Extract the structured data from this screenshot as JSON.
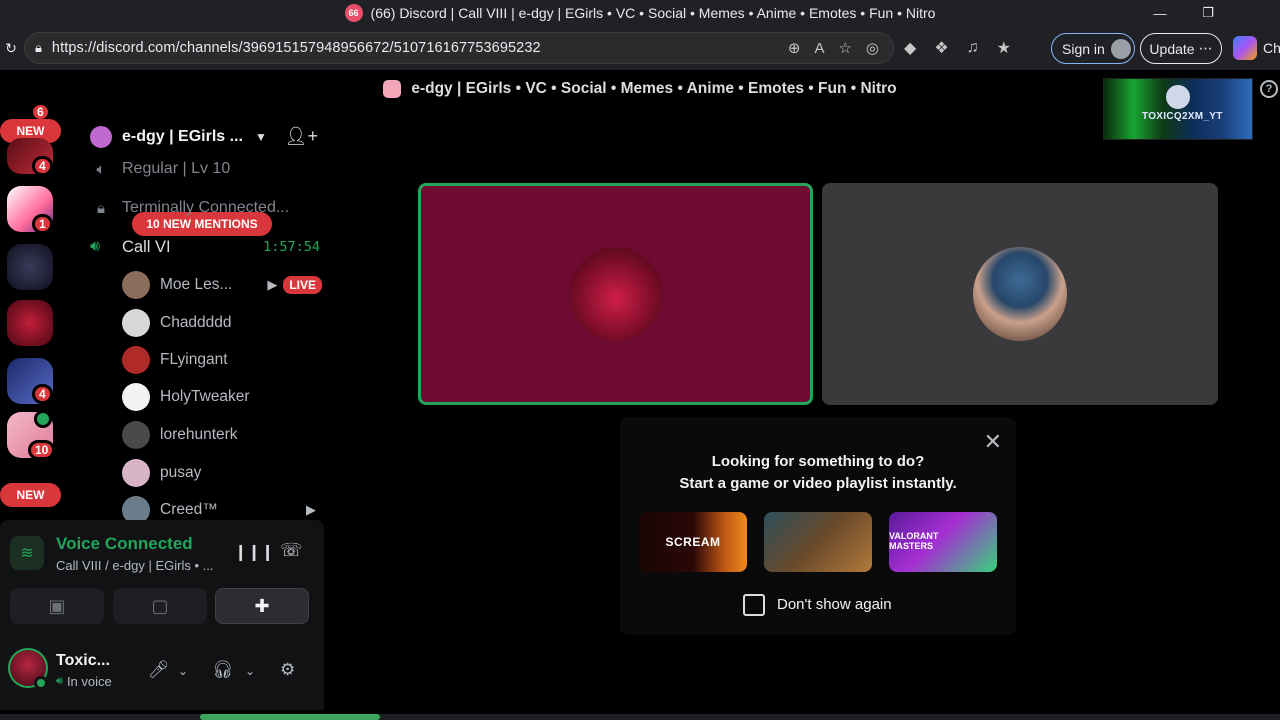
{
  "browser": {
    "tab_badge": "66",
    "tab_title": "(66) Discord | Call VIII | e-dgy | EGirls • VC • Social • Memes • Anime • Emotes • Fun • Nitro",
    "url": "https://discord.com/channels/396915157948956672/510716167753695232",
    "signin_label": "Sign in",
    "update_label": "Update",
    "copilot_label": "Ch"
  },
  "server_header": {
    "title": "e-dgy | EGirls • VC • Social • Memes • Anime • Emotes • Fun • Nitro"
  },
  "overlay": {
    "text": "TOXICQ2XM_YT"
  },
  "rail": {
    "new_label_top": "NEW",
    "new_label_bottom": "NEW",
    "badges": [
      "6",
      "4",
      "1",
      "4",
      "10"
    ]
  },
  "sidebar": {
    "guild_name": "e-dgy | EGirls ...",
    "channels": [
      {
        "name": "Regular | Lv 10",
        "icon": "speaker-icon"
      },
      {
        "name": "Terminally Connected...",
        "icon": "lock-icon"
      }
    ],
    "mentions_label": "10 NEW MENTIONS",
    "call": {
      "name": "Call VI",
      "time": "1:57:54"
    },
    "members": [
      {
        "name": "Moe Les...",
        "live": "LIVE",
        "color": "#8a6d5c"
      },
      {
        "name": "Chaddddd",
        "color": "#d8d8d8"
      },
      {
        "name": "FLyingant",
        "color": "#b02a2a"
      },
      {
        "name": "HolyTweaker",
        "color": "#f2f2f2"
      },
      {
        "name": "lorehunterk",
        "color": "#4a4a4a"
      },
      {
        "name": "pusay",
        "color": "#d9b3c6"
      },
      {
        "name": "Creed™",
        "color": "#6b7c8a"
      }
    ]
  },
  "voice": {
    "title": "Voice Connected",
    "subtitle": "Call VIII / e-dgy | EGirls • ..."
  },
  "user": {
    "name": "Toxic...",
    "status": "In voice"
  },
  "activity": {
    "line1": "Looking for something to do?",
    "line2": "Start a game or video playlist instantly.",
    "card1": "SCREAM",
    "card3": "VALORANT MASTERS",
    "dont_show": "Don't show again"
  }
}
